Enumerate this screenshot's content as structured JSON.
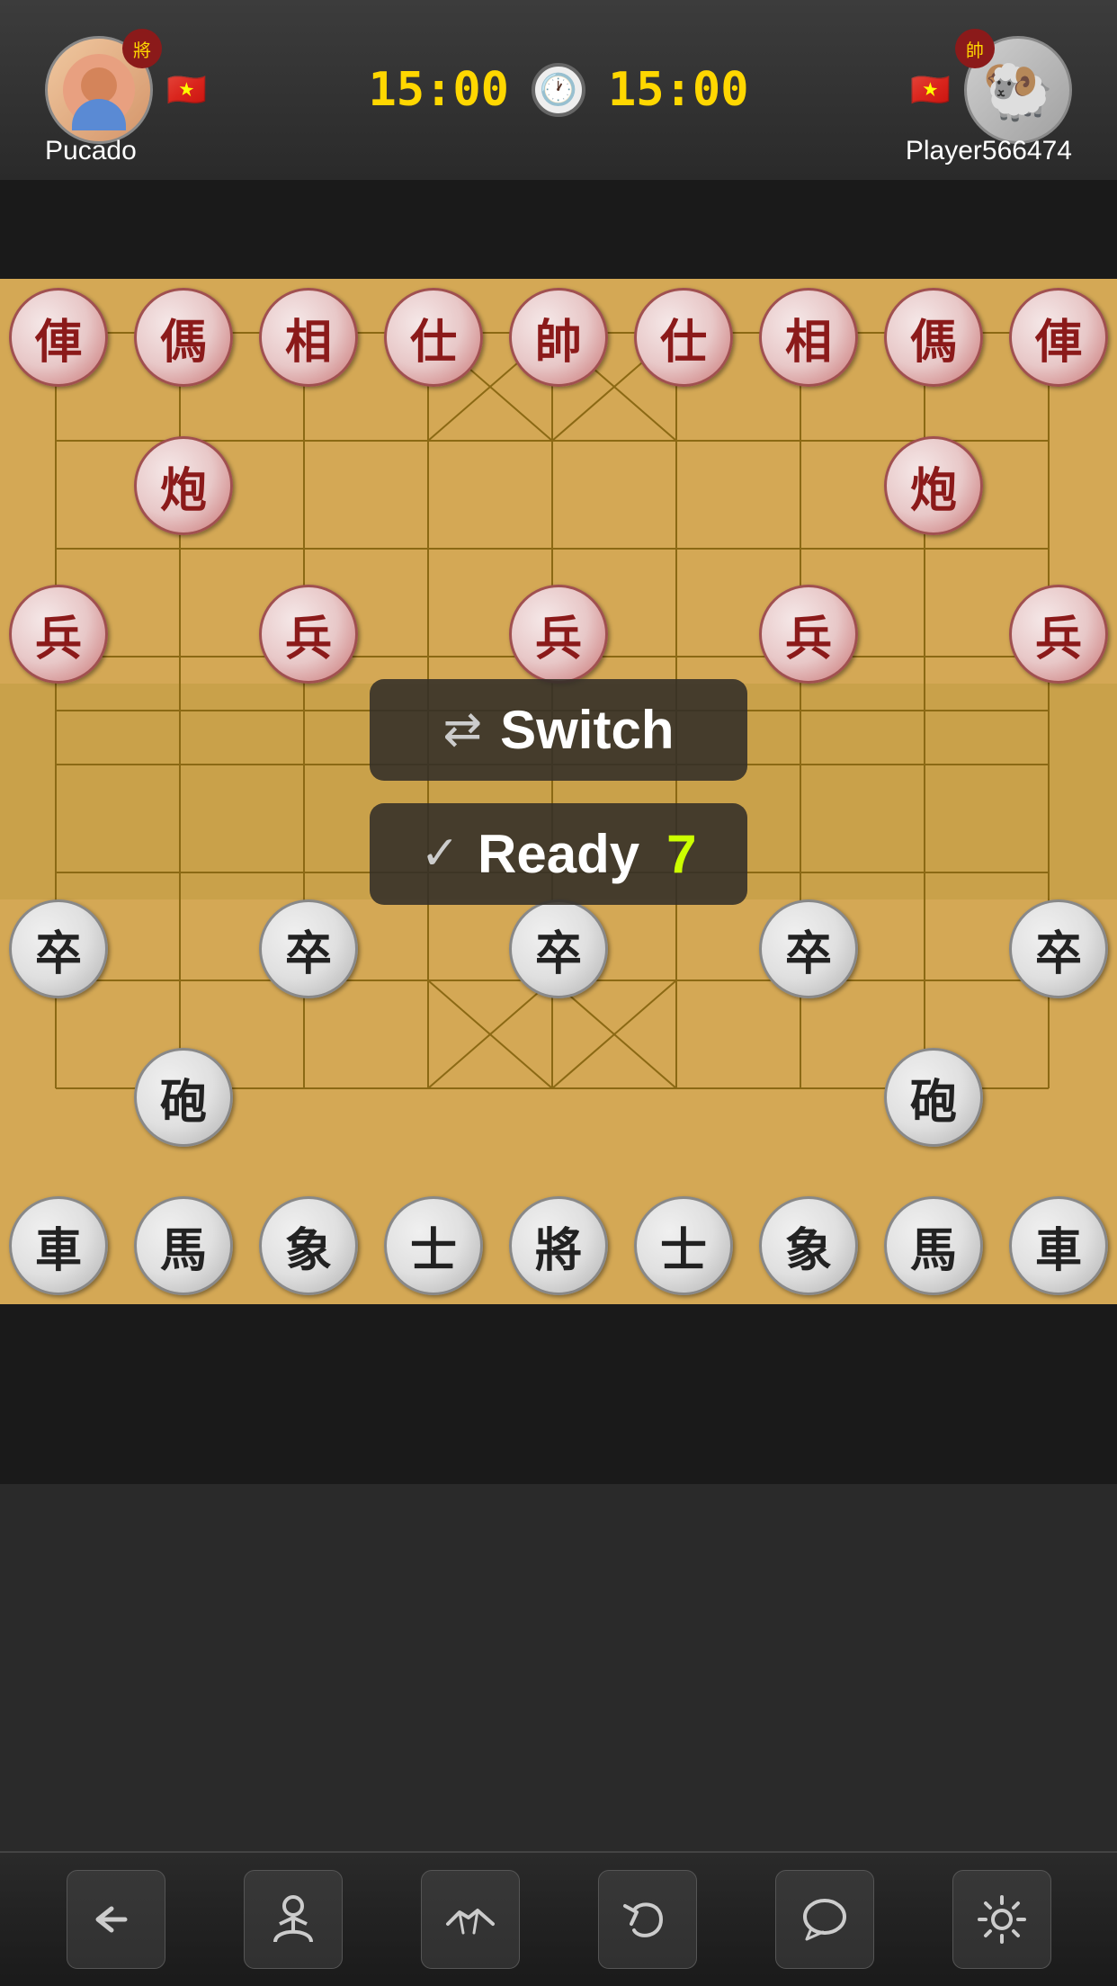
{
  "header": {
    "player1": {
      "name": "Pucado",
      "badge": "將",
      "flag": "🇻🇳",
      "timer": "15:00"
    },
    "player2": {
      "name": "Player566474",
      "badge": "帥",
      "flag": "🇻🇳",
      "timer": "15:00"
    },
    "clock": "🕐"
  },
  "board": {
    "top_row": [
      "俥",
      "傌",
      "相",
      "仕",
      "帥",
      "仕",
      "相",
      "傌",
      "俥"
    ],
    "top_cannon_row": [
      "",
      "炮",
      "",
      "",
      "",
      "",
      "",
      "炮",
      ""
    ],
    "top_pawn_row": [
      "兵",
      "",
      "兵",
      "",
      "兵",
      "",
      "兵",
      "",
      "兵"
    ],
    "bottom_pawn_row": [
      "卒",
      "",
      "卒",
      "",
      "卒",
      "",
      "卒",
      "",
      "卒"
    ],
    "bottom_cannon_row": [
      "",
      "砲",
      "",
      "",
      "",
      "",
      "",
      "砲",
      ""
    ],
    "bottom_row": [
      "車",
      "馬",
      "象",
      "士",
      "將",
      "士",
      "象",
      "馬",
      "車"
    ]
  },
  "overlay": {
    "switch_label": "Switch",
    "ready_label": "Ready",
    "ready_count": "7"
  },
  "toolbar": {
    "back": "←",
    "player_icon": "♟",
    "handshake": "🤝",
    "undo": "↩",
    "chat": "💬",
    "settings": "⚙"
  }
}
